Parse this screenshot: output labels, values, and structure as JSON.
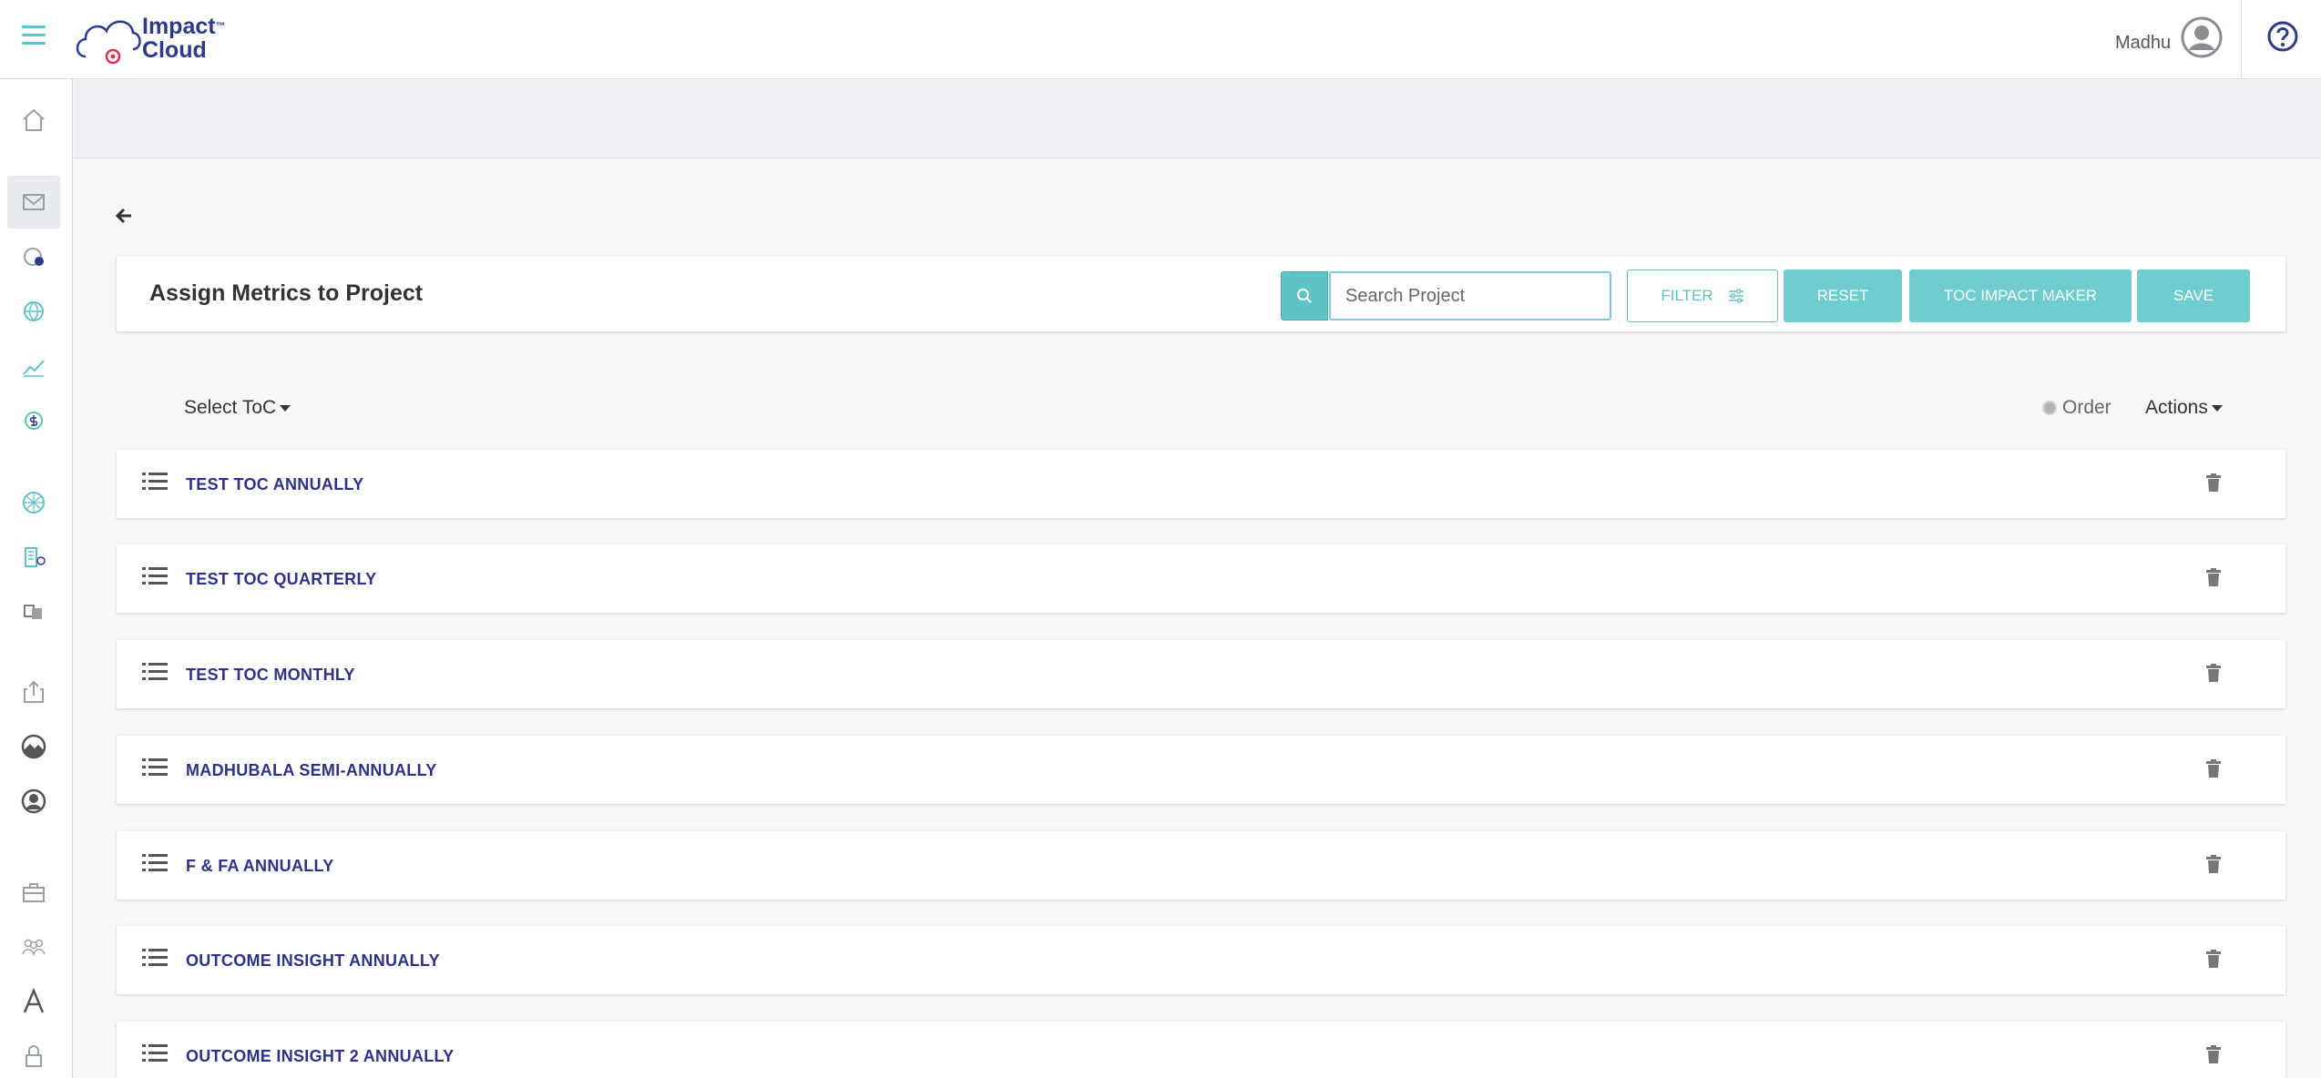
{
  "header": {
    "brand_line1": "Impact",
    "brand_tm": "™",
    "brand_line2": "Cloud",
    "user_name": "Madhu"
  },
  "icons": {
    "menu": "hamburger-menu-icon",
    "avatar": "user-avatar-icon",
    "help": "question-circle-icon",
    "back": "arrow-left-icon",
    "search": "search-icon",
    "filter": "sliders-icon",
    "row_drag": "list-icon",
    "row_delete": "trash-icon"
  },
  "colors": {
    "accent": "#5fc3c6",
    "button_fill": "#6fcdd0",
    "row_label": "#2e3188",
    "brand": "#2d3a8c"
  },
  "page": {
    "title": "Assign Metrics to Project",
    "search_placeholder": "Search Project",
    "filter_label": "FILTER",
    "reset_label": "RESET",
    "toc_impact_maker_label": "TOC IMPACT MAKER",
    "save_label": "SAVE",
    "select_toc_label": "Select ToC",
    "order_label": "Order",
    "actions_label": "Actions"
  },
  "toc_rows": [
    {
      "label": "TEST TOC ANNUALLY"
    },
    {
      "label": "TEST TOC QUARTERLY"
    },
    {
      "label": "TEST TOC MONTHLY"
    },
    {
      "label": "MADHUBALA SEMI-ANNUALLY"
    },
    {
      "label": "F & FA ANNUALLY"
    },
    {
      "label": "OUTCOME INSIGHT ANNUALLY"
    },
    {
      "label": "OUTCOME INSIGHT 2 ANNUALLY"
    }
  ]
}
